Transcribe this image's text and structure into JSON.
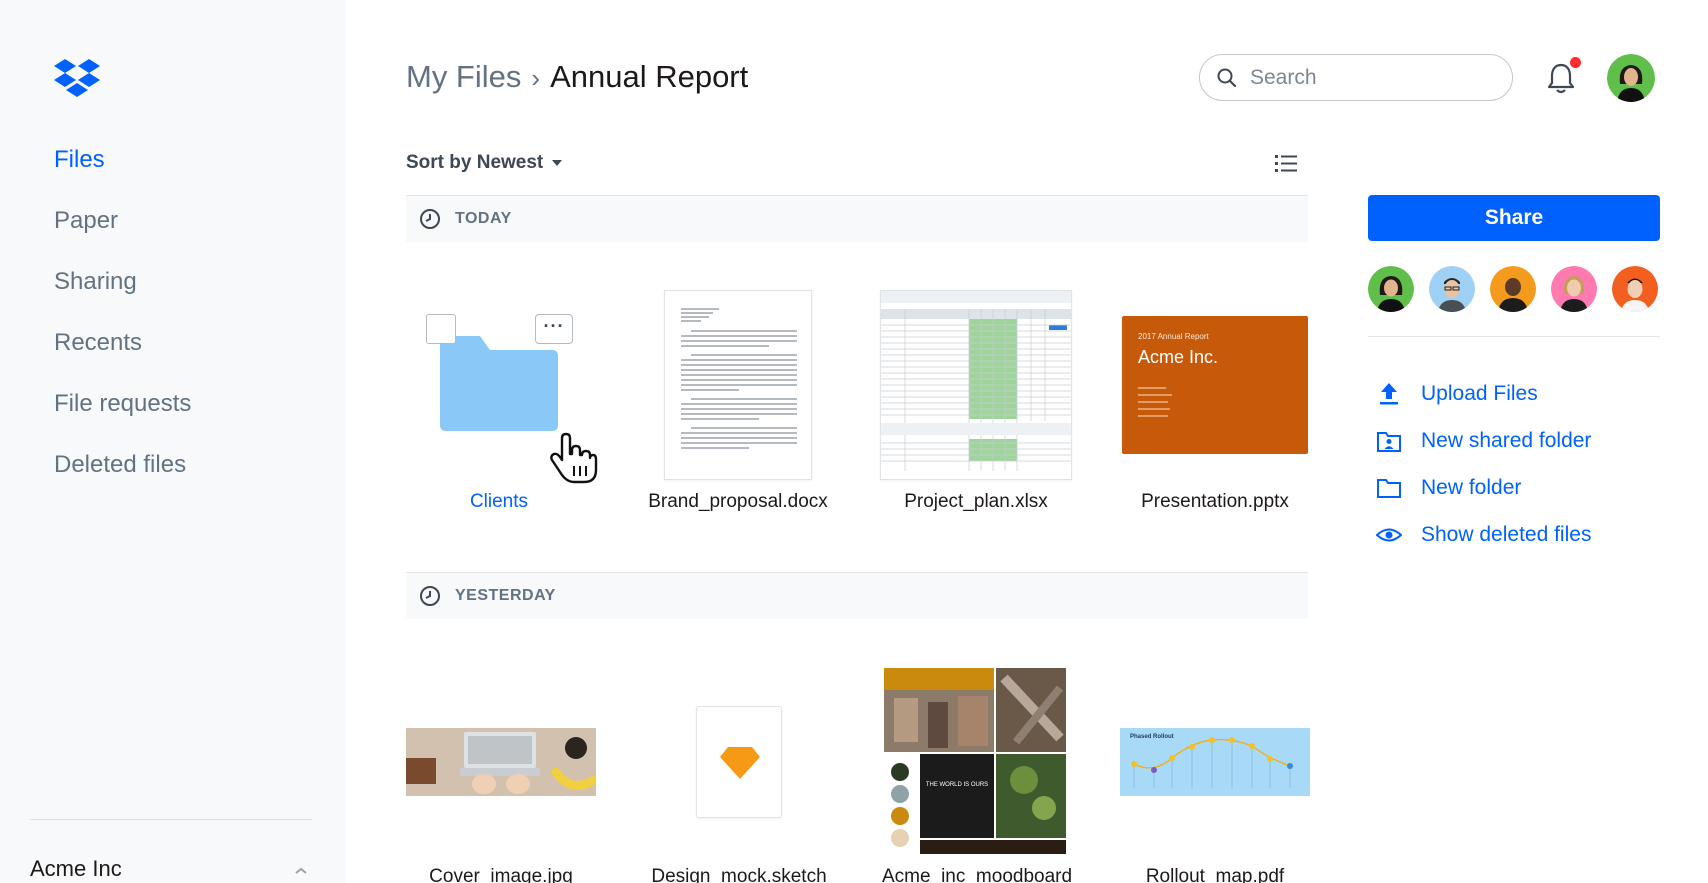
{
  "sidebar": {
    "nav": [
      "Files",
      "Paper",
      "Sharing",
      "Recents",
      "File requests",
      "Deleted files"
    ],
    "active": "Files",
    "team": "Acme Inc"
  },
  "header": {
    "breadcrumb": {
      "parent": "My Files",
      "separator": "›",
      "current": "Annual Report"
    },
    "search": {
      "placeholder": "Search",
      "value": ""
    },
    "notification_dot_color": "#ff2d2d"
  },
  "toolbar": {
    "sort_label": "Sort by Newest"
  },
  "sections": {
    "today": {
      "title": "TODAY",
      "files": [
        {
          "name": "Clients",
          "kind": "folder"
        },
        {
          "name": "Brand_proposal.docx",
          "kind": "document"
        },
        {
          "name": "Project_plan.xlsx",
          "kind": "spreadsheet"
        },
        {
          "name": "Presentation.pptx",
          "kind": "presentation",
          "thumb_title": "Acme Inc.",
          "thumb_subtitle": "2017 Annual Report"
        }
      ]
    },
    "yesterday": {
      "title": "YESTERDAY",
      "files": [
        {
          "name": "Cover_image.jpg",
          "kind": "image"
        },
        {
          "name": "Design_mock.sketch",
          "kind": "sketch"
        },
        {
          "name": "Acme_inc_moodboard",
          "kind": "image",
          "thumb_text": "THE WORLD IS OURS"
        },
        {
          "name": "Rollout_map.pdf",
          "kind": "pdf",
          "thumb_title": "Phased Rollout"
        }
      ]
    }
  },
  "panel": {
    "share_label": "Share",
    "actions": [
      "Upload Files",
      "New shared folder",
      "New folder",
      "Show deleted files"
    ]
  },
  "colors": {
    "accent": "#0061fe",
    "folder": "#8ac8f7",
    "presentation": "#c65a0a"
  },
  "icons": {
    "logo": "dropbox-logo",
    "search": "search-icon",
    "bell": "bell-icon",
    "list": "list-view-icon",
    "clock": "clock-icon"
  }
}
